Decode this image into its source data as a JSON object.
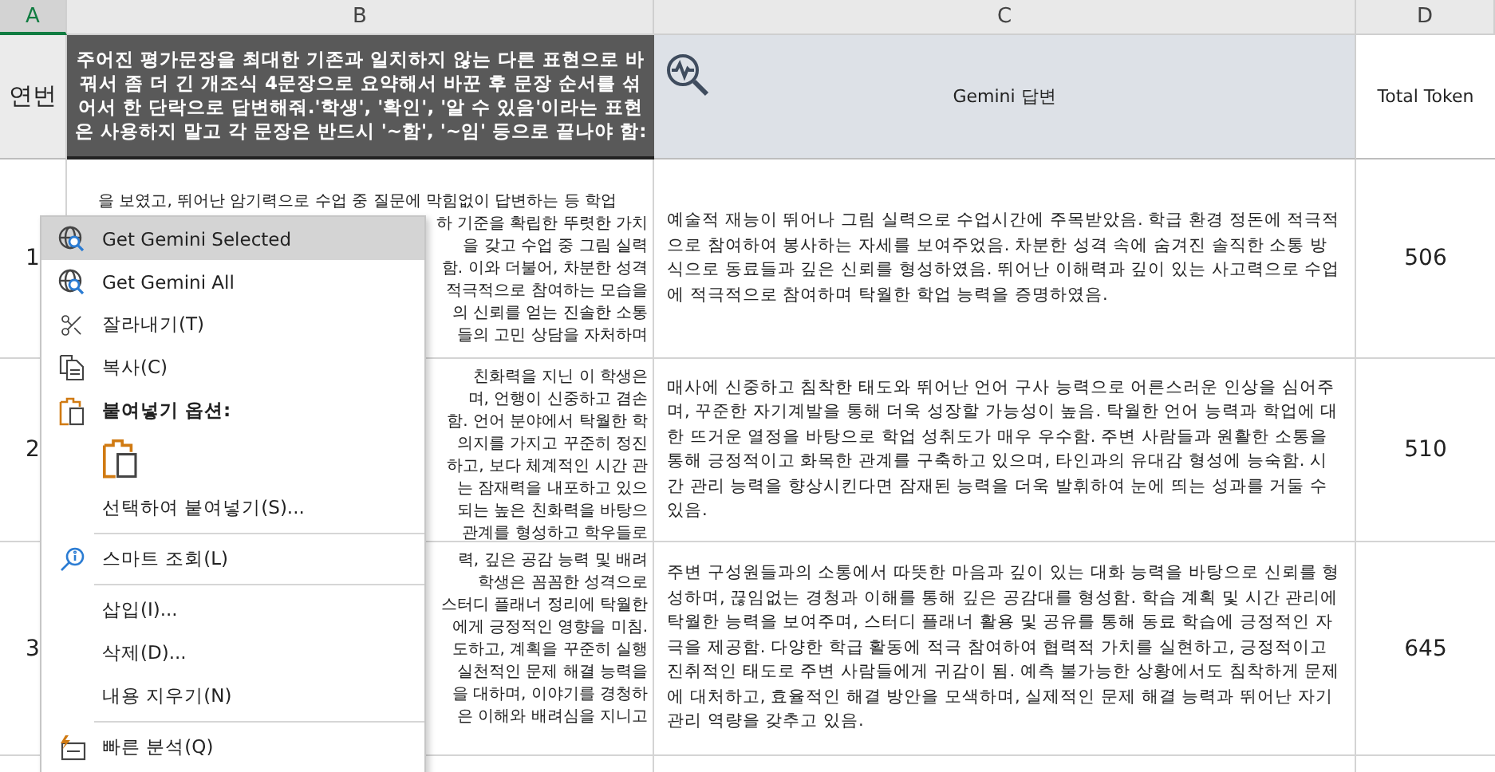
{
  "columns": [
    {
      "letter": "A",
      "selected": true
    },
    {
      "letter": "B",
      "selected": false
    },
    {
      "letter": "C",
      "selected": false
    },
    {
      "letter": "D",
      "selected": false
    }
  ],
  "header": {
    "col_a": "연번",
    "col_b": "주어진 평가문장을 최대한 기존과 일치하지 않는 다른 표현으로 바꿔서 좀 더 긴 개조식 4문장으로 요약해서 바꾼 후 문장 순서를 섞어서 한 단락으로 답변해줘.'학생', '확인', '알 수 있음'이라는 표현은 사용하지 말고 각 문장은 반드시 '~함', '~임' 등으로 끝나야 함:",
    "col_c": "Gemini 답변",
    "col_d": "Total Token"
  },
  "rows": [
    {
      "number": "1",
      "b_lines": [
        {
          "kind": "full",
          "text": "을 보였고, 뛰어난 암기력으로 수업 중 질문에 막힘없이 답변하는 등 학업"
        },
        {
          "kind": "fragment",
          "text": "하 기준을 확립한 뚜렷한 가치"
        },
        {
          "kind": "fragment",
          "text": "을 갖고 수업 중 그림 실력"
        },
        {
          "kind": "fragment",
          "text": "함. 이와 더불어, 차분한 성격"
        },
        {
          "kind": "fragment",
          "text": "적극적으로 참여하는 모습을"
        },
        {
          "kind": "fragment",
          "text": "의 신뢰를 얻는 진솔한 소통"
        },
        {
          "kind": "fragment",
          "text": "들의 고민 상담을 자처하며"
        }
      ],
      "answer": "예술적 재능이 뛰어나 그림 실력으로 수업시간에 주목받았음. 학급 환경 정돈에 적극적으로 참여하여 봉사하는 자세를 보여주었음. 차분한 성격 속에 숨겨진 솔직한 소통 방식으로 동료들과 깊은 신뢰를 형성하였음. 뛰어난 이해력과 깊이 있는 사고력으로 수업에 적극적으로 참여하며 탁월한 학업 능력을 증명하였음.",
      "tokens": "506"
    },
    {
      "number": "2",
      "b_lines": [
        {
          "kind": "fragment",
          "text": "친화력을 지닌 이 학생은"
        },
        {
          "kind": "fragment",
          "text": "며, 언행이 신중하고 겸손"
        },
        {
          "kind": "fragment",
          "text": "함. 언어 분야에서 탁월한 학"
        },
        {
          "kind": "fragment",
          "text": "의지를 가지고 꾸준히 정진"
        },
        {
          "kind": "fragment",
          "text": "하고, 보다 체계적인 시간 관"
        },
        {
          "kind": "fragment",
          "text": "는 잠재력을 내포하고 있으"
        },
        {
          "kind": "fragment",
          "text": "되는 높은 친화력을 바탕으"
        },
        {
          "kind": "fragment",
          "text": "관계를 형성하고 학우들로"
        }
      ],
      "answer": "매사에 신중하고 침착한 태도와 뛰어난 언어 구사 능력으로 어른스러운 인상을 심어주며, 꾸준한 자기계발을 통해 더욱 성장할 가능성이 높음. 탁월한 언어 능력과 학업에 대한 뜨거운 열정을 바탕으로 학업 성취도가 매우 우수함. 주변 사람들과 원활한 소통을 통해 긍정적이고 화목한 관계를 구축하고 있으며, 타인과의 유대감 형성에 능숙함. 시간 관리 능력을 향상시킨다면 잠재된 능력을 더욱 발휘하여 눈에 띄는 성과를 거둘 수 있음.",
      "tokens": "510"
    },
    {
      "number": "3",
      "b_lines": [
        {
          "kind": "fragment",
          "text": "력, 깊은 공감 능력 및 배려"
        },
        {
          "kind": "fragment",
          "text": "학생은 꼼꼼한 성격으로"
        },
        {
          "kind": "fragment",
          "text": "스터디 플래너 정리에 탁월한"
        },
        {
          "kind": "fragment",
          "text": "에게 긍정적인 영향을 미침."
        },
        {
          "kind": "fragment",
          "text": "도하고, 계획을 꾸준히 실행"
        },
        {
          "kind": "fragment",
          "text": "실천적인 문제 해결 능력을"
        },
        {
          "kind": "fragment",
          "text": "을 대하며, 이야기를 경청하"
        },
        {
          "kind": "fragment",
          "text": "은 이해와 배려심을 지니고"
        }
      ],
      "answer": "주변 구성원들과의 소통에서 따뜻한 마음과 깊이 있는 대화 능력을 바탕으로 신뢰를 형성하며, 끊임없는 경청과 이해를 통해 깊은 공감대를 형성함. 학습 계획 및 시간 관리에 탁월한 능력을 보여주며, 스터디 플래너 활용 및 공유를 통해 동료 학습에 긍정적인 자극을 제공함. 다양한 학급 활동에 적극 참여하여 협력적 가치를 실현하고, 긍정적이고 진취적인 태도로 주변 사람들에게 귀감이 됨. 예측 불가능한 상황에서도 침착하게 문제에 대처하고, 효율적인 해결 방안을 모색하며, 실제적인 문제 해결 능력과 뛰어난 자기 관리 역량을 갖추고 있음.",
      "tokens": "645"
    }
  ],
  "context_menu": {
    "items": [
      {
        "kind": "item",
        "label": "Get Gemini Selected",
        "selected": true
      },
      {
        "kind": "item",
        "label": "Get Gemini All",
        "selected": false
      },
      {
        "kind": "item",
        "label": "잘라내기(T)",
        "selected": false
      },
      {
        "kind": "item",
        "label": "복사(C)",
        "selected": false
      },
      {
        "kind": "heading",
        "label": "붙여넣기 옵션:"
      },
      {
        "kind": "paste-option"
      },
      {
        "kind": "item",
        "label": "선택하여 붙여넣기(S)...",
        "selected": false
      },
      {
        "kind": "separator"
      },
      {
        "kind": "item",
        "label": "스마트 조회(L)",
        "selected": false
      },
      {
        "kind": "separator"
      },
      {
        "kind": "item",
        "label": "삽입(I)...",
        "selected": false
      },
      {
        "kind": "item",
        "label": "삭제(D)...",
        "selected": false
      },
      {
        "kind": "item",
        "label": "내용 지우기(N)",
        "selected": false
      },
      {
        "kind": "separator"
      },
      {
        "kind": "item",
        "label": "빠른 분석(Q)",
        "selected": false
      }
    ]
  }
}
